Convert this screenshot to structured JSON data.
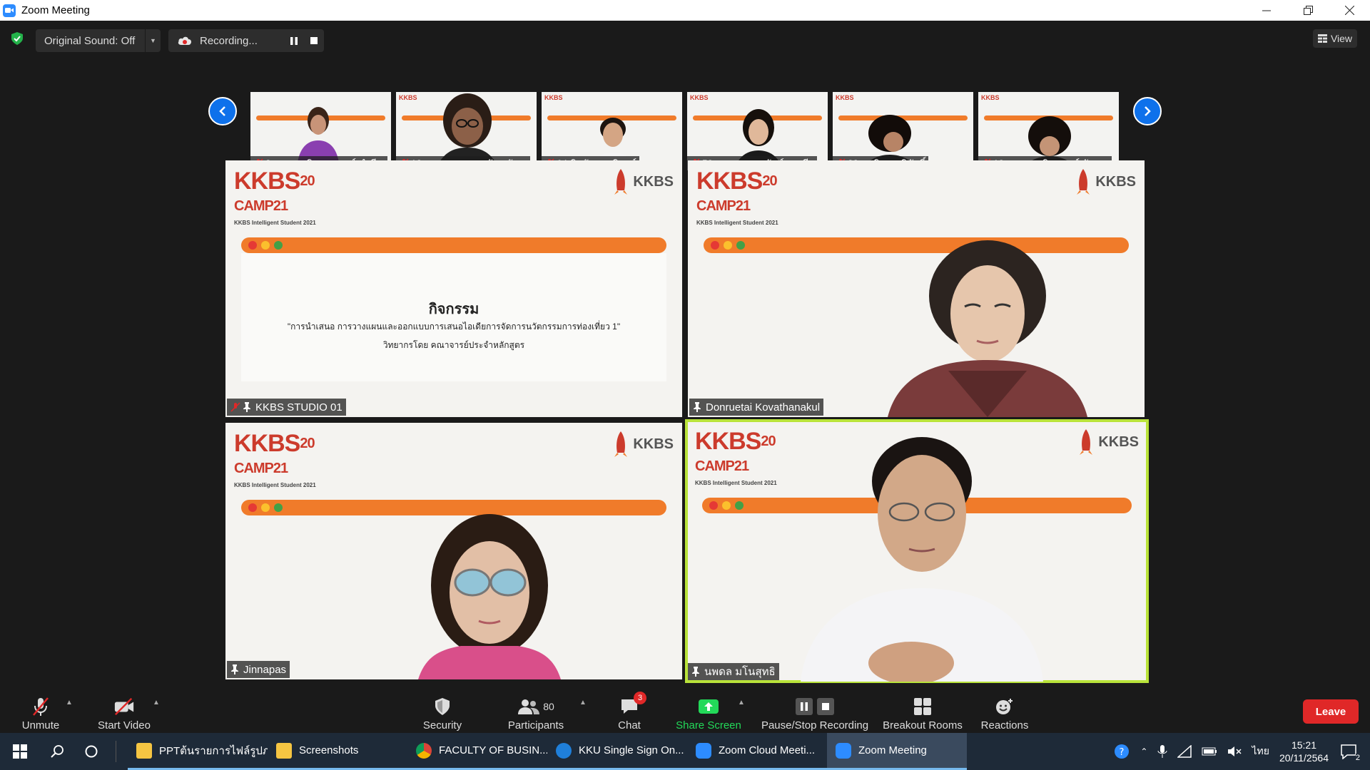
{
  "window": {
    "title": "Zoom Meeting"
  },
  "topbar": {
    "original_sound": "Original Sound: Off",
    "recording": "Recording...",
    "view": "View"
  },
  "thumbnails": [
    {
      "name": "8.นางสาวจิตตราภรณ์ คำสี..."
    },
    {
      "name": "12. นางสาวพรรณภัทร กัน..."
    },
    {
      "name": "64-ธินวัตร วารินทร์"
    },
    {
      "name": "50-นางสาวสรารัตน์  มูลเพีย"
    },
    {
      "name": "28-มานิดา ภูมิภักดิ์"
    },
    {
      "name": "13.นางสาวณิชกานต์ กันม..."
    }
  ],
  "tiles": [
    {
      "name": "KKBS STUDIO 01"
    },
    {
      "name": "Donruetai Kovathanakul"
    },
    {
      "name": "Jinnapas"
    },
    {
      "name": "นพดล มโนสุทธิ"
    }
  ],
  "slide": {
    "logo": "KKBS",
    "logo_year_top": "20",
    "logo_camp": "CAMP",
    "logo_year_bottom": "21",
    "logo_sub": "KKBS Intelligent Student 2021",
    "right_logo": "KKBS",
    "heading": "กิจกรรม",
    "line1": "\"การนำเสนอ การวางแผนและออกแบบการเสนอไอเดียการจัดการนวัตกรรมการท่องเที่ยว 1\"",
    "line2": "วิทยากรโดย คณาจารย์ประจำหลักสูตร"
  },
  "toolbar": {
    "unmute": "Unmute",
    "start_video": "Start Video",
    "security": "Security",
    "participants": "Participants",
    "participants_count": "80",
    "chat": "Chat",
    "chat_badge": "3",
    "share_screen": "Share Screen",
    "pause_stop": "Pause/Stop Recording",
    "breakout": "Breakout Rooms",
    "reactions": "Reactions",
    "leave": "Leave"
  },
  "taskbar": {
    "apps": [
      {
        "label": "PPTต้นรายการไฟล์รูปภ..."
      },
      {
        "label": "Screenshots"
      },
      {
        "label": "FACULTY OF BUSIN..."
      },
      {
        "label": "KKU Single Sign On..."
      },
      {
        "label": "Zoom Cloud Meeti..."
      },
      {
        "label": "Zoom Meeting"
      }
    ],
    "lang": "ไทย",
    "time": "15:21",
    "date": "20/11/2564",
    "notif_count": "2"
  },
  "colors": {
    "accent": "#0e71eb",
    "active_speaker": "#b9e33a",
    "leave": "#e02828",
    "share": "#23d959"
  }
}
